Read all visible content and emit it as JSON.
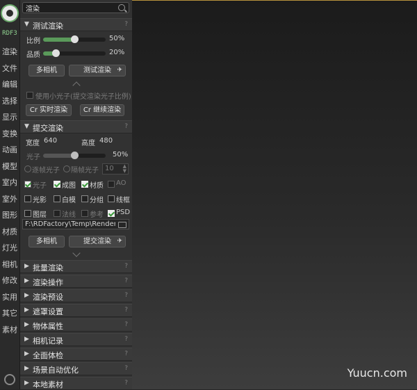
{
  "search": {
    "value": "渲染"
  },
  "brand": "RDF3",
  "nav": [
    "渲染",
    "文件",
    "编辑",
    "选择",
    "显示",
    "变换",
    "动画",
    "模型",
    "室内",
    "室外",
    "图形",
    "材质",
    "灯光",
    "相机",
    "修改",
    "实用",
    "其它",
    "素材"
  ],
  "test_render": {
    "title": "测试渲染",
    "scale_label": "比例",
    "scale_value": "50%",
    "scale": 0.5,
    "quality_label": "品质",
    "quality_value": "20%",
    "quality": 0.2,
    "multi_cam": "多相机",
    "test_btn": "测试渲染",
    "small_photon": "使用小光子(提交渲染光子比例)",
    "cr_realtime": "Cr 实时渲染",
    "cr_continue": "Cr 继续渲染"
  },
  "submit_render": {
    "title": "提交渲染",
    "width_label": "宽度",
    "width_value": "640",
    "height_label": "高度",
    "height_value": "480",
    "photon_label": "光子",
    "photon_value": "50%",
    "photon": 0.5,
    "frame_photon": "逐帧光子",
    "interval_photon": "隔帧光子",
    "interval_value": "10",
    "passes": [
      {
        "label": "光子",
        "checked": true,
        "dim": true
      },
      {
        "label": "成图",
        "checked": true,
        "dim": false
      },
      {
        "label": "材质",
        "checked": true,
        "dim": false
      },
      {
        "label": "AO",
        "checked": false,
        "dim": true
      },
      {
        "label": "光影",
        "checked": false,
        "dim": false
      },
      {
        "label": "白模",
        "checked": false,
        "dim": false
      },
      {
        "label": "分组",
        "checked": false,
        "dim": false
      },
      {
        "label": "线框",
        "checked": false,
        "dim": false
      },
      {
        "label": "图层",
        "checked": false,
        "dim": false
      },
      {
        "label": "法线",
        "checked": false,
        "dim": true
      },
      {
        "label": "参考",
        "checked": false,
        "dim": true
      },
      {
        "label": "PSD",
        "checked": true,
        "dim": false
      }
    ],
    "path": "F:\\RDFactory\\Temp\\Render\\",
    "multi_cam": "多相机",
    "submit_btn": "提交渲染"
  },
  "sections": [
    "批量渲染",
    "渲染操作",
    "渲染预设",
    "遮罩设置",
    "物体属性",
    "相机记录",
    "全面体检",
    "场景自动优化",
    "本地素材"
  ],
  "help": "?",
  "watermark": "Yuucn.com",
  "colors": {
    "accent": "#5a9a5a",
    "panel": "#323232"
  }
}
